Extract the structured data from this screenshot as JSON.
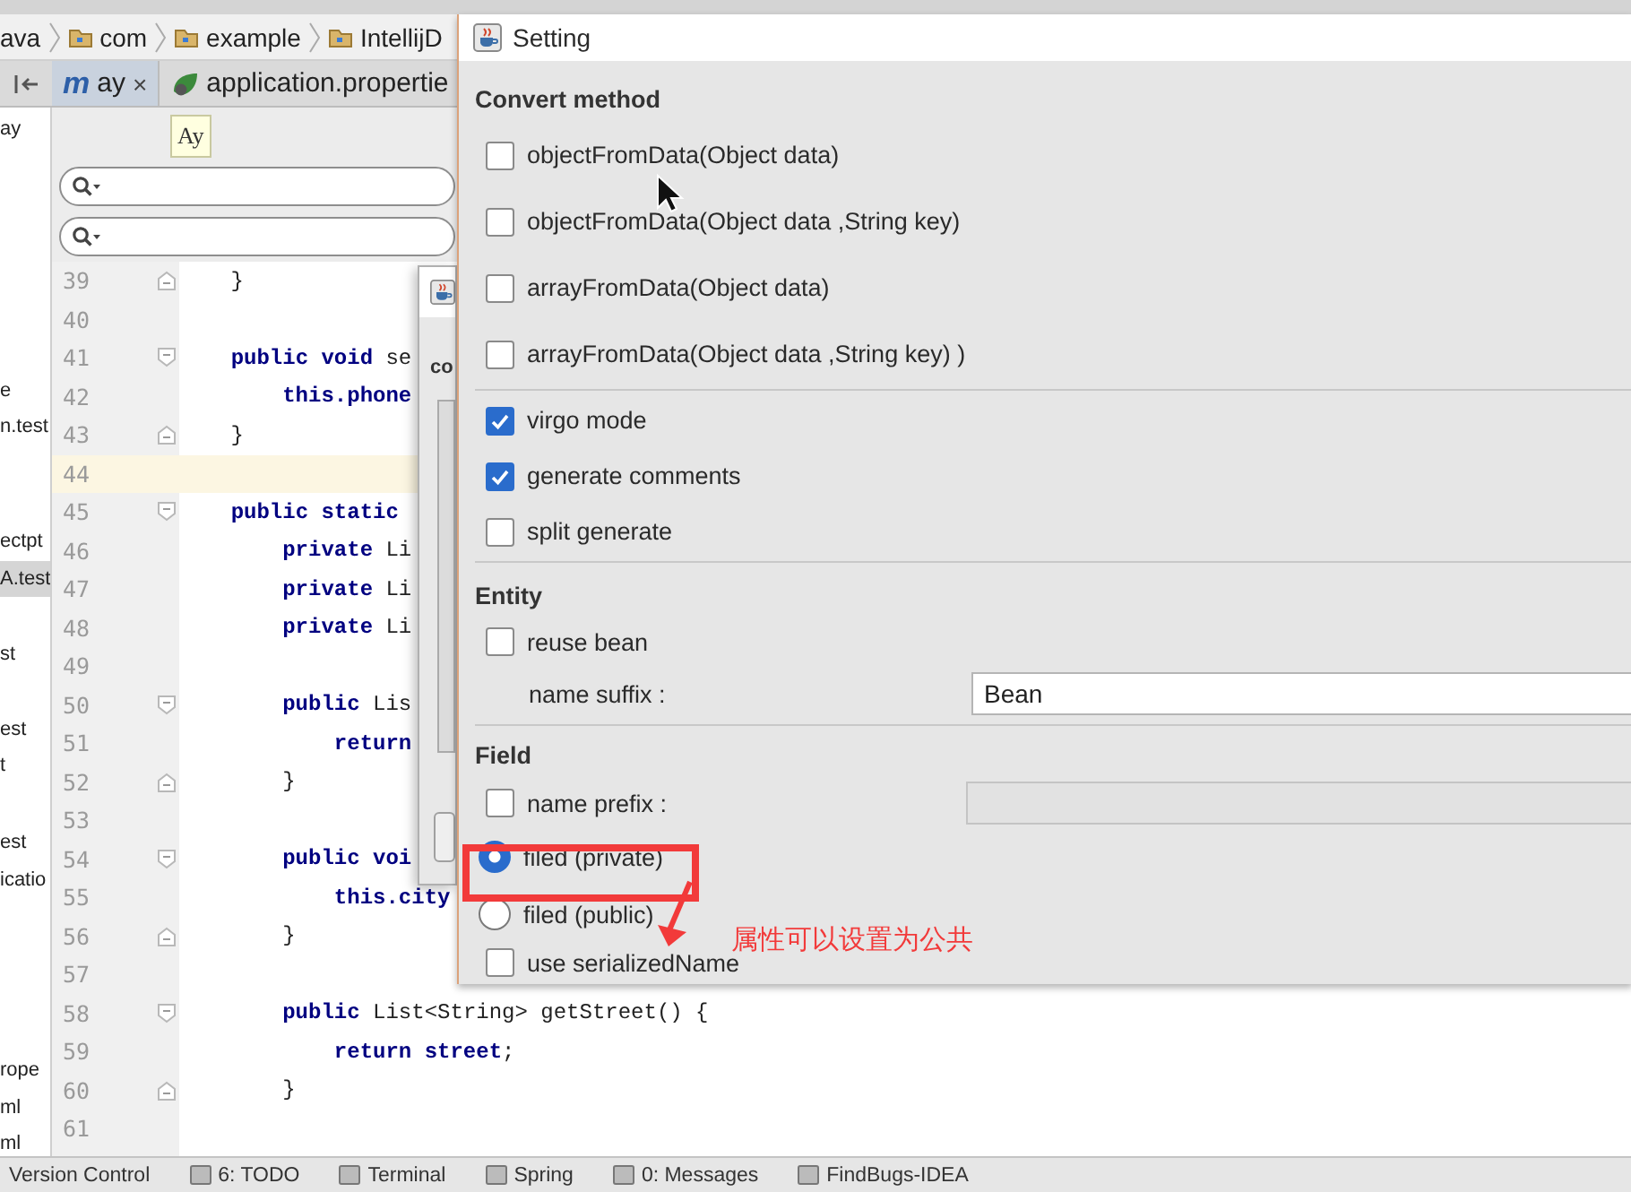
{
  "breadcrumbs": [
    {
      "label": "ava",
      "kind": "text"
    },
    {
      "label": "com",
      "kind": "folder"
    },
    {
      "label": "example",
      "kind": "folder"
    },
    {
      "label": "IntellijD",
      "kind": "folder"
    }
  ],
  "editor_tabs": [
    {
      "badge": "m",
      "label": "ay",
      "close": "×",
      "selected": true,
      "kind": "class"
    },
    {
      "label": "application.propertie",
      "selected": false,
      "kind": "spring"
    }
  ],
  "tooltip": "Ay",
  "search_fields": [
    {
      "kind": "search"
    },
    {
      "kind": "search"
    }
  ],
  "project_tree": [
    {
      "label": "ay",
      "selected": false
    },
    {
      "label": "e",
      "selected": false
    },
    {
      "label": "n.test",
      "selected": false
    },
    {
      "label": "ectpt",
      "selected": false
    },
    {
      "label": "A.test",
      "selected": true
    },
    {
      "label": "st",
      "selected": false
    },
    {
      "label": "est",
      "selected": false
    },
    {
      "label": "t",
      "selected": false
    },
    {
      "label": "est",
      "selected": false
    },
    {
      "label": "icatio",
      "selected": false
    },
    {
      "label": "rope",
      "selected": false
    },
    {
      "label": "ml",
      "selected": false
    },
    {
      "label": "ml",
      "selected": false
    }
  ],
  "code_lines": [
    {
      "number": "39",
      "text": "    }",
      "kind": "closing",
      "current": false
    },
    {
      "number": "40",
      "kind": "plain",
      "current": false
    },
    {
      "number": "41",
      "text": "    **public void** se",
      "kind": "opening",
      "current": false
    },
    {
      "number": "42",
      "text": "        **this.phone**",
      "kind": "plain",
      "current": false
    },
    {
      "number": "43",
      "text": "    }",
      "kind": "closing",
      "current": false
    },
    {
      "number": "44",
      "kind": "plain",
      "current": true
    },
    {
      "number": "45",
      "text": "    **public static**",
      "kind": "opening",
      "current": false
    },
    {
      "number": "46",
      "text": "        **private** Li",
      "kind": "plain",
      "current": false
    },
    {
      "number": "47",
      "text": "        **private** Li",
      "kind": "plain",
      "current": false
    },
    {
      "number": "48",
      "text": "        **private** Li",
      "kind": "plain",
      "current": false
    },
    {
      "number": "49",
      "kind": "plain",
      "current": false
    },
    {
      "number": "50",
      "text": "        **public** Lis",
      "kind": "opening",
      "current": false
    },
    {
      "number": "51",
      "text": "            **return**",
      "kind": "plain",
      "current": false
    },
    {
      "number": "52",
      "text": "        }",
      "kind": "closing",
      "current": false
    },
    {
      "number": "53",
      "kind": "plain",
      "current": false
    },
    {
      "number": "54",
      "text": "        **public voi**",
      "kind": "opening",
      "current": false
    },
    {
      "number": "55",
      "text": "            **this.city**",
      "kind": "plain",
      "current": false
    },
    {
      "number": "56",
      "text": "        }",
      "kind": "closing",
      "current": false
    },
    {
      "number": "57",
      "kind": "plain",
      "current": false
    },
    {
      "number": "58",
      "text": "        **public** List<String> getStreet() {",
      "kind": "opening",
      "current": false
    },
    {
      "number": "59",
      "text": "            **return street**;",
      "kind": "plain",
      "current": false
    },
    {
      "number": "60",
      "text": "        }",
      "kind": "closing",
      "current": false
    },
    {
      "number": "61",
      "kind": "plain",
      "current": false
    }
  ],
  "back_dialog": {
    "text": "co"
  },
  "setting_dialog": {
    "title": "Setting",
    "convert_method": {
      "heading": "Convert method",
      "options": [
        {
          "label": "objectFromData(Object data)",
          "checked": false
        },
        {
          "label": "objectFromData(Object data ,String key)",
          "checked": false
        },
        {
          "label": "arrayFromData(Object data)",
          "checked": false
        },
        {
          "label": "arrayFromData(Object data ,String key) )",
          "checked": false
        }
      ]
    },
    "flags": [
      {
        "label": "virgo mode",
        "checked": true
      },
      {
        "label": "generate comments",
        "checked": true
      },
      {
        "label": "split generate",
        "checked": false
      }
    ],
    "entity": {
      "heading": "Entity",
      "reuse_bean": {
        "label": "reuse bean",
        "checked": false
      },
      "name_suffix": {
        "label": "name suffix :",
        "value": "Bean"
      }
    },
    "field": {
      "heading": "Field",
      "name_prefix": {
        "label": "name prefix :",
        "checked": false,
        "disabled": true
      },
      "visibility": [
        {
          "label": "filed (private)",
          "selected": true
        },
        {
          "label": "filed (public)",
          "selected": false
        }
      ],
      "serialized_name": {
        "label": "use serializedName",
        "checked": false
      }
    }
  },
  "annotation": {
    "text": "属性可以设置为公共"
  },
  "status_bar": [
    "Version Control",
    "6: TODO",
    "Terminal",
    "Spring",
    "0: Messages",
    "FindBugs-IDEA"
  ]
}
